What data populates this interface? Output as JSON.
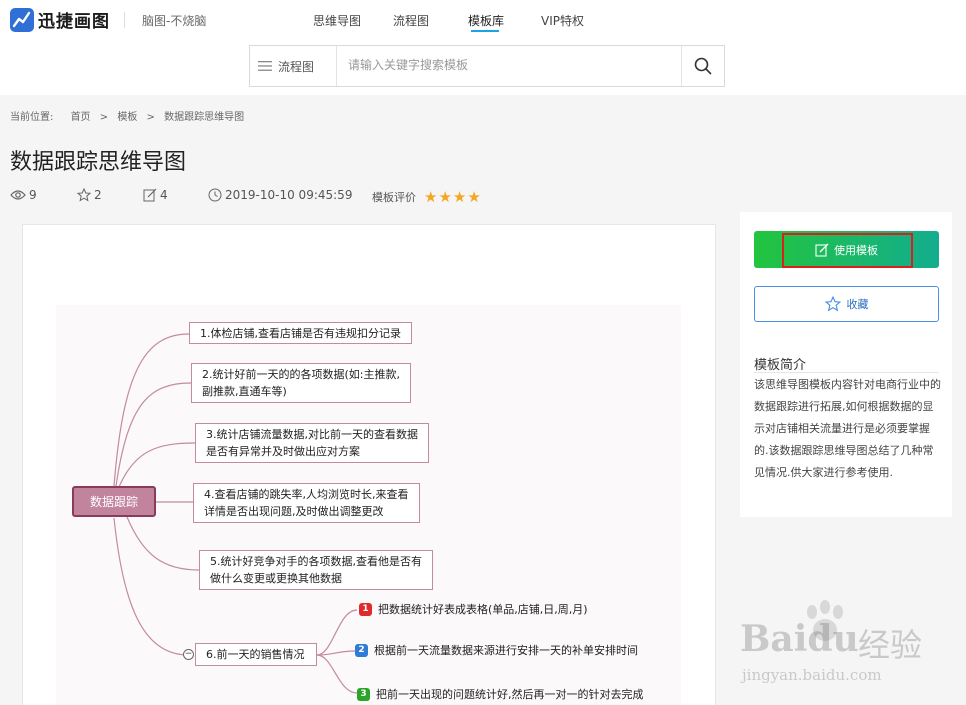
{
  "header": {
    "logo_text": "迅捷画图",
    "slogan": "脑图-不烧脑",
    "nav": [
      "思维导图",
      "流程图",
      "模板库",
      "VIP特权"
    ],
    "search_category": "流程图",
    "search_placeholder": "请输入关键字搜索模板"
  },
  "breadcrumb": {
    "prefix": "当前位置:",
    "items": [
      "首页",
      "模板",
      "数据跟踪思维导图"
    ],
    "separator": ">"
  },
  "page": {
    "title": "数据跟踪思维导图",
    "views": "9",
    "likes": "2",
    "edits": "4",
    "datetime": "2019-10-10 09:45:59",
    "rating_label": "模板评价",
    "rating": 4
  },
  "mindmap": {
    "root": "数据跟踪",
    "branches": [
      {
        "line1": "1.体检店铺,查看店铺是否有违规扣分记录",
        "line2": ""
      },
      {
        "line1": "2.统计好前一天的的各项数据(如:主推款,",
        "line2": "副推款,直通车等)"
      },
      {
        "line1": "3.统计店铺流量数据,对比前一天的查看数据",
        "line2": "是否有异常并及时做出应对方案"
      },
      {
        "line1": "4.查看店铺的跳失率,人均浏览时长,来查看",
        "line2": "详情是否出现问题,及时做出调整更改"
      },
      {
        "line1": "5.统计好竞争对手的各项数据,查看他是否有",
        "line2": "做什么变更或更换其他数据"
      },
      {
        "line1": "6.前一天的销售情况",
        "line2": ""
      }
    ],
    "subtasks": [
      {
        "num": "1",
        "text": "把数据统计好表成表格(单品,店铺,日,周,月)",
        "color": "#e02b2b"
      },
      {
        "num": "2",
        "text": "根据前一天流量数据来源进行安排一天的补单安排时间",
        "color": "#2f7bd6"
      },
      {
        "num": "3",
        "text": "把前一天出现的问题统计好,然后再一对一的针对去完成",
        "color": "#2aa52a"
      }
    ],
    "collapse_symbol": "−"
  },
  "sidebar": {
    "use_label": "使用模板",
    "fav_label": "收藏",
    "intro_title": "模板简介",
    "intro_text": "该思维导图模板内容针对电商行业中的数据跟踪进行拓展,如何根据数据的显示对店铺相关流量进行是必须要掌握的.该数据跟踪思维导图总结了几种常见情况.供大家进行参考使用."
  },
  "watermark": {
    "brand": "Baidu",
    "cn": "经验",
    "url": "jingyan.baidu.com"
  },
  "colors": {
    "accent_blue": "#1aa3e6",
    "use_green": "#23c43e",
    "star": "#f5a623",
    "root_fill": "#c2849c",
    "highlight_red": "#d9201f"
  }
}
